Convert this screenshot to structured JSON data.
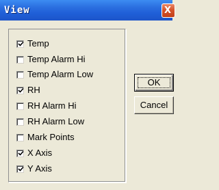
{
  "window": {
    "title": "View",
    "close_glyph": "X"
  },
  "options": [
    {
      "label": "Temp",
      "checked": true
    },
    {
      "label": "Temp Alarm Hi",
      "checked": false
    },
    {
      "label": "Temp Alarm Low",
      "checked": false
    },
    {
      "label": "RH",
      "checked": true
    },
    {
      "label": "RH Alarm Hi",
      "checked": false
    },
    {
      "label": "RH Alarm Low",
      "checked": false
    },
    {
      "label": "Mark Points",
      "checked": false
    },
    {
      "label": "X Axis",
      "checked": true
    },
    {
      "label": "Y Axis",
      "checked": true
    }
  ],
  "buttons": {
    "ok_label": "OK",
    "cancel_label": "Cancel"
  },
  "colors": {
    "titlebar": "#1f5fd7",
    "close_button": "#d6532b",
    "dialog_background": "#ece9d8"
  }
}
